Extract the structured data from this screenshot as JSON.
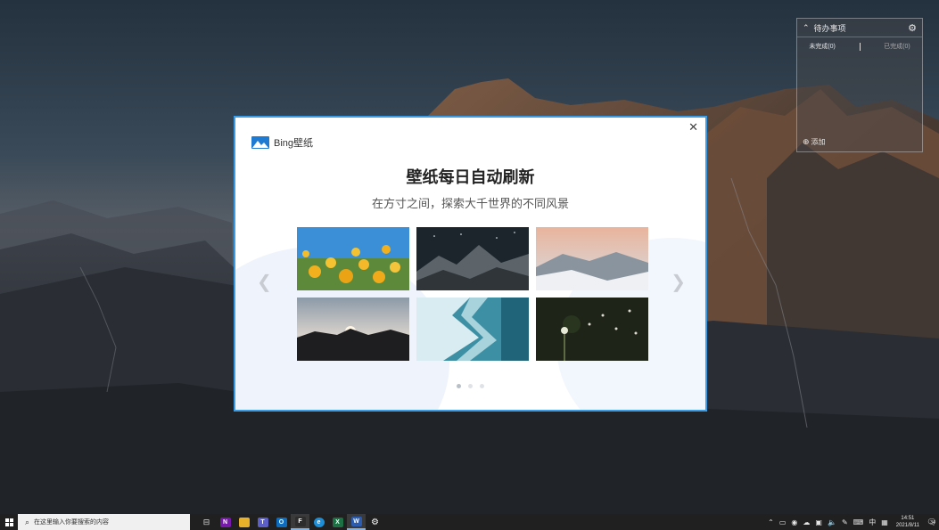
{
  "todo_widget": {
    "title": "待办事项",
    "tab_pending": "未完成(0)",
    "tab_done": "已完成(0)",
    "add_label": "添加"
  },
  "dialog": {
    "brand_name": "Bing壁纸",
    "headline": "壁纸每日自动刷新",
    "subline": "在方寸之间，探索大千世界的不同风景",
    "thumbnails": [
      {
        "subject": "yellow flowers"
      },
      {
        "subject": "night mountains"
      },
      {
        "subject": "misty peaks"
      },
      {
        "subject": "sunset mountains"
      },
      {
        "subject": "ocean waves"
      },
      {
        "subject": "dandelion"
      }
    ],
    "pager": {
      "count": 3,
      "active": 0
    }
  },
  "taskbar": {
    "search_placeholder": "在这里输入你要搜索的内容",
    "apps": [
      {
        "name": "task-view-icon",
        "color": "#202020",
        "glyph": "⊟"
      },
      {
        "name": "onenote-icon",
        "color": "#7719aa",
        "glyph": "N"
      },
      {
        "name": "file-explorer-icon",
        "color": "#e8b12a",
        "glyph": ""
      },
      {
        "name": "teams-icon",
        "color": "#5b5fc7",
        "glyph": "T"
      },
      {
        "name": "outlook-icon",
        "color": "#0f6cbd",
        "glyph": "O"
      },
      {
        "name": "figma-icon",
        "color": "#2c2c2c",
        "glyph": "F"
      },
      {
        "name": "edge-icon",
        "color": "#1e8fd6",
        "glyph": "e"
      },
      {
        "name": "excel-icon",
        "color": "#1d7044",
        "glyph": "X"
      },
      {
        "name": "word-icon",
        "color": "#2b5cb0",
        "glyph": "W"
      },
      {
        "name": "settings-icon",
        "color": "#202020",
        "glyph": "⚙"
      }
    ],
    "ime_label": "中",
    "time": "14:51",
    "date": "2021/8/11",
    "notification_count": "34"
  }
}
